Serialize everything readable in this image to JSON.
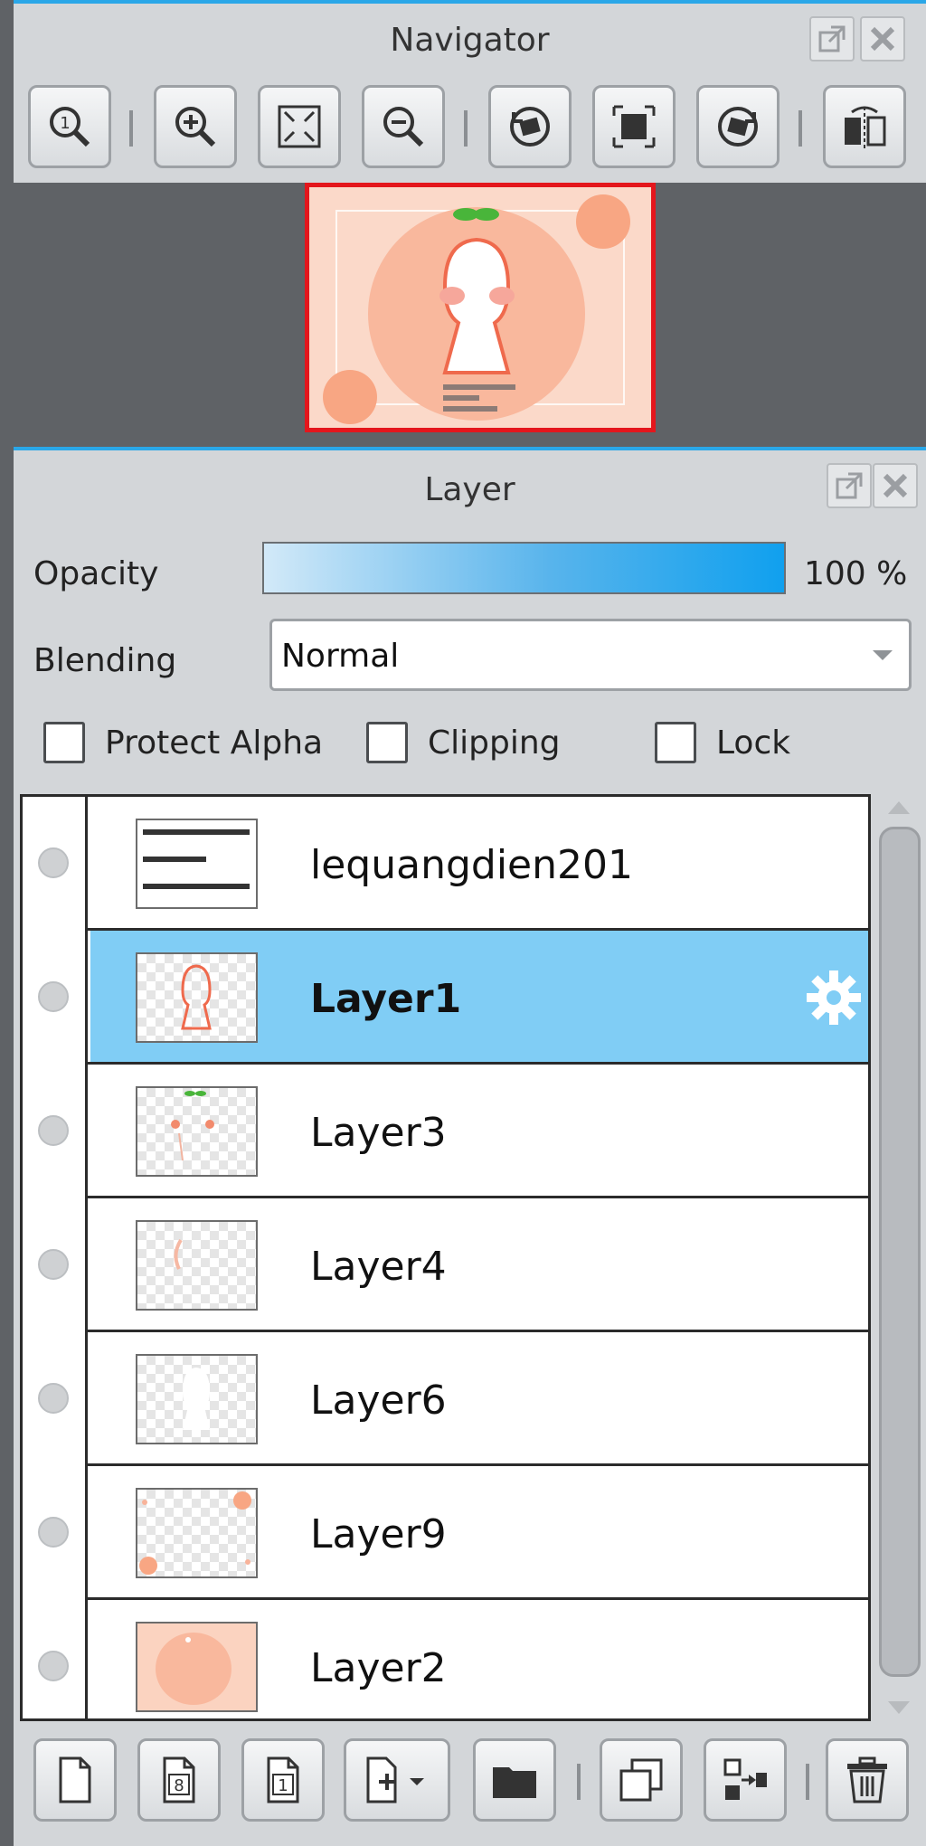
{
  "navigator": {
    "title": "Navigator",
    "title_buttons": [
      "popout-icon",
      "close-icon"
    ],
    "toolbar": [
      "actual-size-icon",
      "zoom-in-icon",
      "fit-window-icon",
      "zoom-out-icon",
      "rotate-left-icon",
      "fit-canvas-icon",
      "rotate-right-icon",
      "flip-horizontal-icon"
    ],
    "preview": {
      "frame_color": "#e4161c",
      "background_color": "#fbd9c9"
    }
  },
  "layer_panel": {
    "title": "Layer",
    "opacity_label": "Opacity",
    "opacity_value": "100 %",
    "opacity_fraction": 1.0,
    "blending_label": "Blending",
    "blending_value": "Normal",
    "checkboxes": {
      "protect_alpha": "Protect Alpha",
      "clipping": "Clipping",
      "lock": "Lock"
    },
    "layers": [
      {
        "name": "lequangdien201",
        "selected": false
      },
      {
        "name": "Layer1",
        "selected": true
      },
      {
        "name": "Layer3",
        "selected": false
      },
      {
        "name": "Layer4",
        "selected": false
      },
      {
        "name": "Layer6",
        "selected": false
      },
      {
        "name": "Layer9",
        "selected": false
      },
      {
        "name": "Layer2",
        "selected": false
      }
    ],
    "bottom_toolbar": [
      "new-layer-icon",
      "new-8bit-layer-icon",
      "new-1bit-layer-icon",
      "add-layer-dropdown-icon",
      "new-folder-icon",
      "duplicate-layer-icon",
      "merge-down-icon",
      "delete-layer-icon"
    ]
  },
  "colors": {
    "accent": "#2aa7e8",
    "selection": "#80cdf5",
    "panel": "#d3d6d9"
  }
}
